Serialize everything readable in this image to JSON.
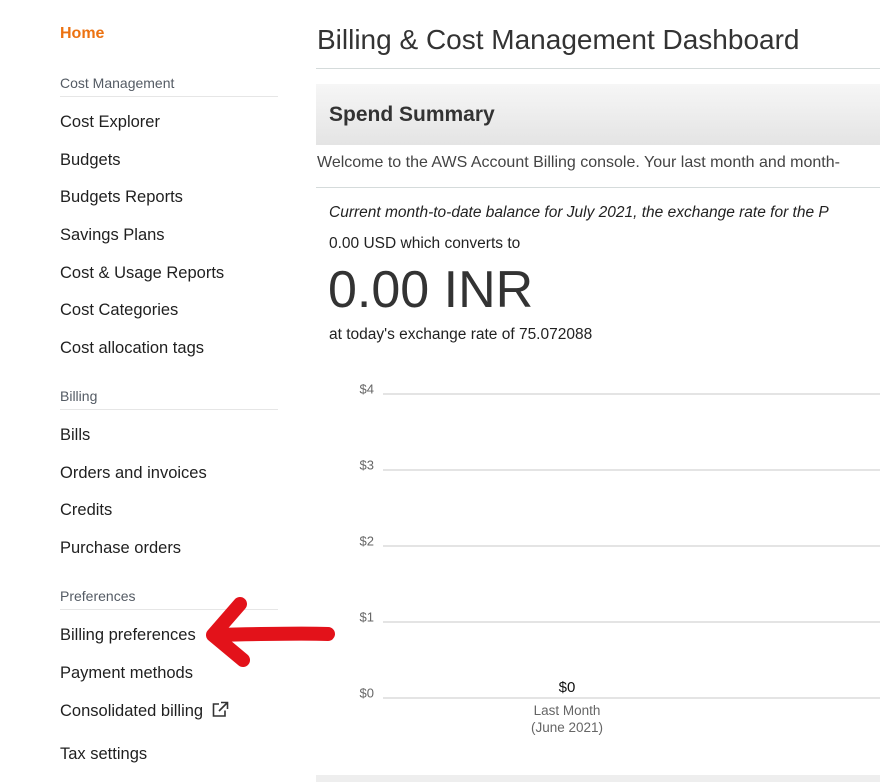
{
  "sidebar": {
    "home_label": "Home",
    "sections": [
      {
        "label": "Cost Management",
        "items": [
          {
            "label": "Cost Explorer"
          },
          {
            "label": "Budgets"
          },
          {
            "label": "Budgets Reports"
          },
          {
            "label": "Savings Plans"
          },
          {
            "label": "Cost & Usage Reports"
          },
          {
            "label": "Cost Categories"
          },
          {
            "label": "Cost allocation tags"
          }
        ]
      },
      {
        "label": "Billing",
        "items": [
          {
            "label": "Bills"
          },
          {
            "label": "Orders and invoices"
          },
          {
            "label": "Credits"
          },
          {
            "label": "Purchase orders"
          }
        ]
      },
      {
        "label": "Preferences",
        "items": [
          {
            "label": "Billing preferences"
          },
          {
            "label": "Payment methods"
          },
          {
            "label": "Consolidated billing",
            "icon": "external-link-icon"
          },
          {
            "label": "Tax settings"
          }
        ]
      }
    ]
  },
  "main": {
    "title": "Billing & Cost Management Dashboard",
    "summary_title": "Spend Summary",
    "welcome_text": "Welcome to the AWS Account Billing console. Your last month and month-",
    "balance_note": "Current month-to-date balance for July 2021, the exchange rate for the P",
    "usd_line": "0.00 USD which converts to",
    "big_amount": "0.00 INR",
    "rate_line": "at today's exchange rate of 75.072088"
  },
  "annotation": {
    "type": "red-arrow-icon",
    "target": "Billing preferences",
    "color": "#e3121a"
  },
  "colors": {
    "home_accent": "#ec7211",
    "chart_grid": "#c8c8c8",
    "axis_text": "#666666"
  },
  "chart_data": {
    "type": "bar",
    "y_ticks": [
      "$4",
      "$3",
      "$2",
      "$1",
      "$0"
    ],
    "ylim": [
      0,
      4
    ],
    "categories": [
      "Last Month\n(June 2021)"
    ],
    "category_lines": [
      [
        "Last Month",
        "(June 2021)"
      ]
    ],
    "values": [
      0
    ],
    "data_labels": [
      "$0"
    ],
    "grid": true
  }
}
